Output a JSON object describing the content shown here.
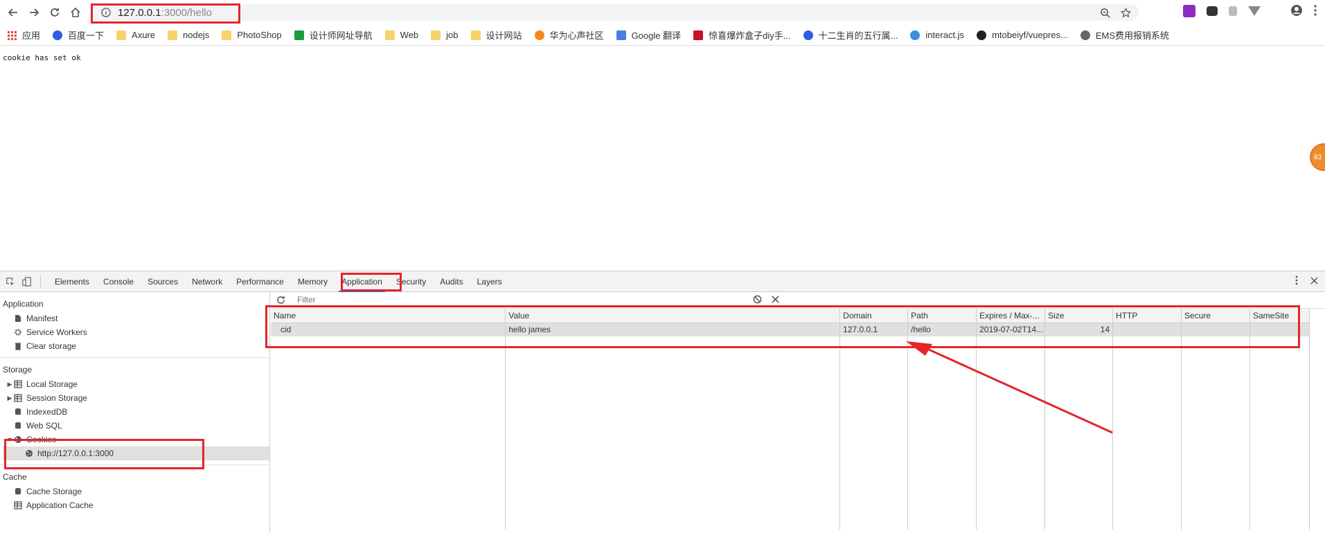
{
  "browser": {
    "url_host": "127.0.0.1",
    "url_path": ":3000/hello",
    "bookmarks": [
      {
        "label": "应用",
        "icon": "apps-grid-icon"
      },
      {
        "label": "百度一下",
        "icon": "baidu-paw-icon"
      },
      {
        "label": "Axure",
        "icon": "folder-icon"
      },
      {
        "label": "nodejs",
        "icon": "folder-icon"
      },
      {
        "label": "PhotoShop",
        "icon": "folder-icon"
      },
      {
        "label": "设计师网址导航",
        "icon": "site-icon"
      },
      {
        "label": "Web",
        "icon": "folder-icon"
      },
      {
        "label": "job",
        "icon": "folder-icon"
      },
      {
        "label": "设计网站",
        "icon": "folder-icon"
      },
      {
        "label": "华为心声社区",
        "icon": "huawei-icon"
      },
      {
        "label": "Google 翻译",
        "icon": "google-translate-icon"
      },
      {
        "label": "惊喜爆炸盒子diy手...",
        "icon": "t-icon"
      },
      {
        "label": "十二生肖的五行属...",
        "icon": "baidu-paw-icon"
      },
      {
        "label": "interact.js",
        "icon": "interact-icon"
      },
      {
        "label": "mtobeiyf/vuepres...",
        "icon": "github-icon"
      },
      {
        "label": "EMS费用报销系统",
        "icon": "globe-icon"
      }
    ]
  },
  "page": {
    "text": "cookie has set ok",
    "badge": "83"
  },
  "devtools": {
    "tabs": [
      "Elements",
      "Console",
      "Sources",
      "Network",
      "Performance",
      "Memory",
      "Application",
      "Security",
      "Audits",
      "Layers"
    ],
    "active_tab": "Application",
    "sidebar": {
      "application_title": "Application",
      "application_items": [
        "Manifest",
        "Service Workers",
        "Clear storage"
      ],
      "storage_title": "Storage",
      "storage_items": [
        "Local Storage",
        "Session Storage",
        "IndexedDB",
        "Web SQL",
        "Cookies"
      ],
      "cookies_child": "http://127.0.0.1:3000",
      "cache_title": "Cache",
      "cache_items": [
        "Cache Storage",
        "Application Cache"
      ]
    },
    "filter_placeholder": "Filter",
    "columns": [
      "Name",
      "Value",
      "Domain",
      "Path",
      "Expires / Max-...",
      "Size",
      "HTTP",
      "Secure",
      "SameSite"
    ],
    "rows": [
      {
        "name": "cid",
        "value": "hello james",
        "domain": "127.0.0.1",
        "path": "/hello",
        "expires": "2019-07-02T14...",
        "size": "14",
        "http": "",
        "secure": "",
        "samesite": ""
      }
    ]
  },
  "colors": {
    "annotation": "#e3242b",
    "active_tab_underline": "#1a73e8",
    "folder": "#f7d26b"
  }
}
